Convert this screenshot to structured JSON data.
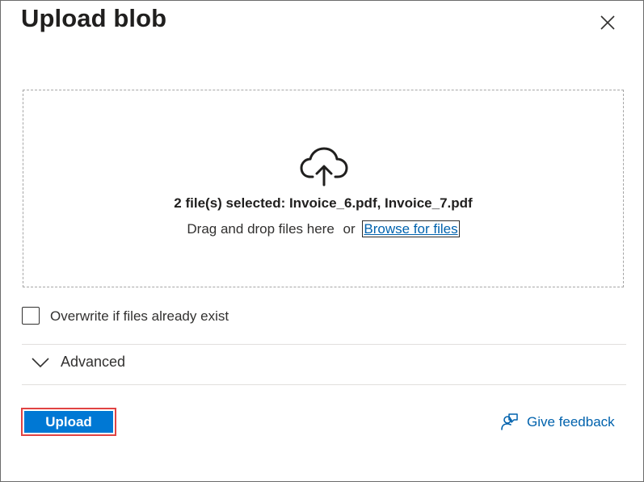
{
  "dialog": {
    "title": "Upload blob"
  },
  "dropzone": {
    "selected_text": "2 file(s) selected: Invoice_6.pdf, Invoice_7.pdf",
    "drag_text": "Drag and drop files here",
    "or_text": "or",
    "browse_label": "Browse for files"
  },
  "options": {
    "overwrite_label": "Overwrite if files already exist",
    "overwrite_checked": false,
    "advanced_label": "Advanced"
  },
  "footer": {
    "upload_label": "Upload",
    "feedback_label": "Give feedback"
  },
  "icons": [
    "close-icon",
    "cloud-upload-icon",
    "chevron-down-icon",
    "feedback-icon"
  ],
  "colors": {
    "accent": "#0078d4",
    "link": "#0062ad",
    "highlight_border": "#e04343"
  }
}
